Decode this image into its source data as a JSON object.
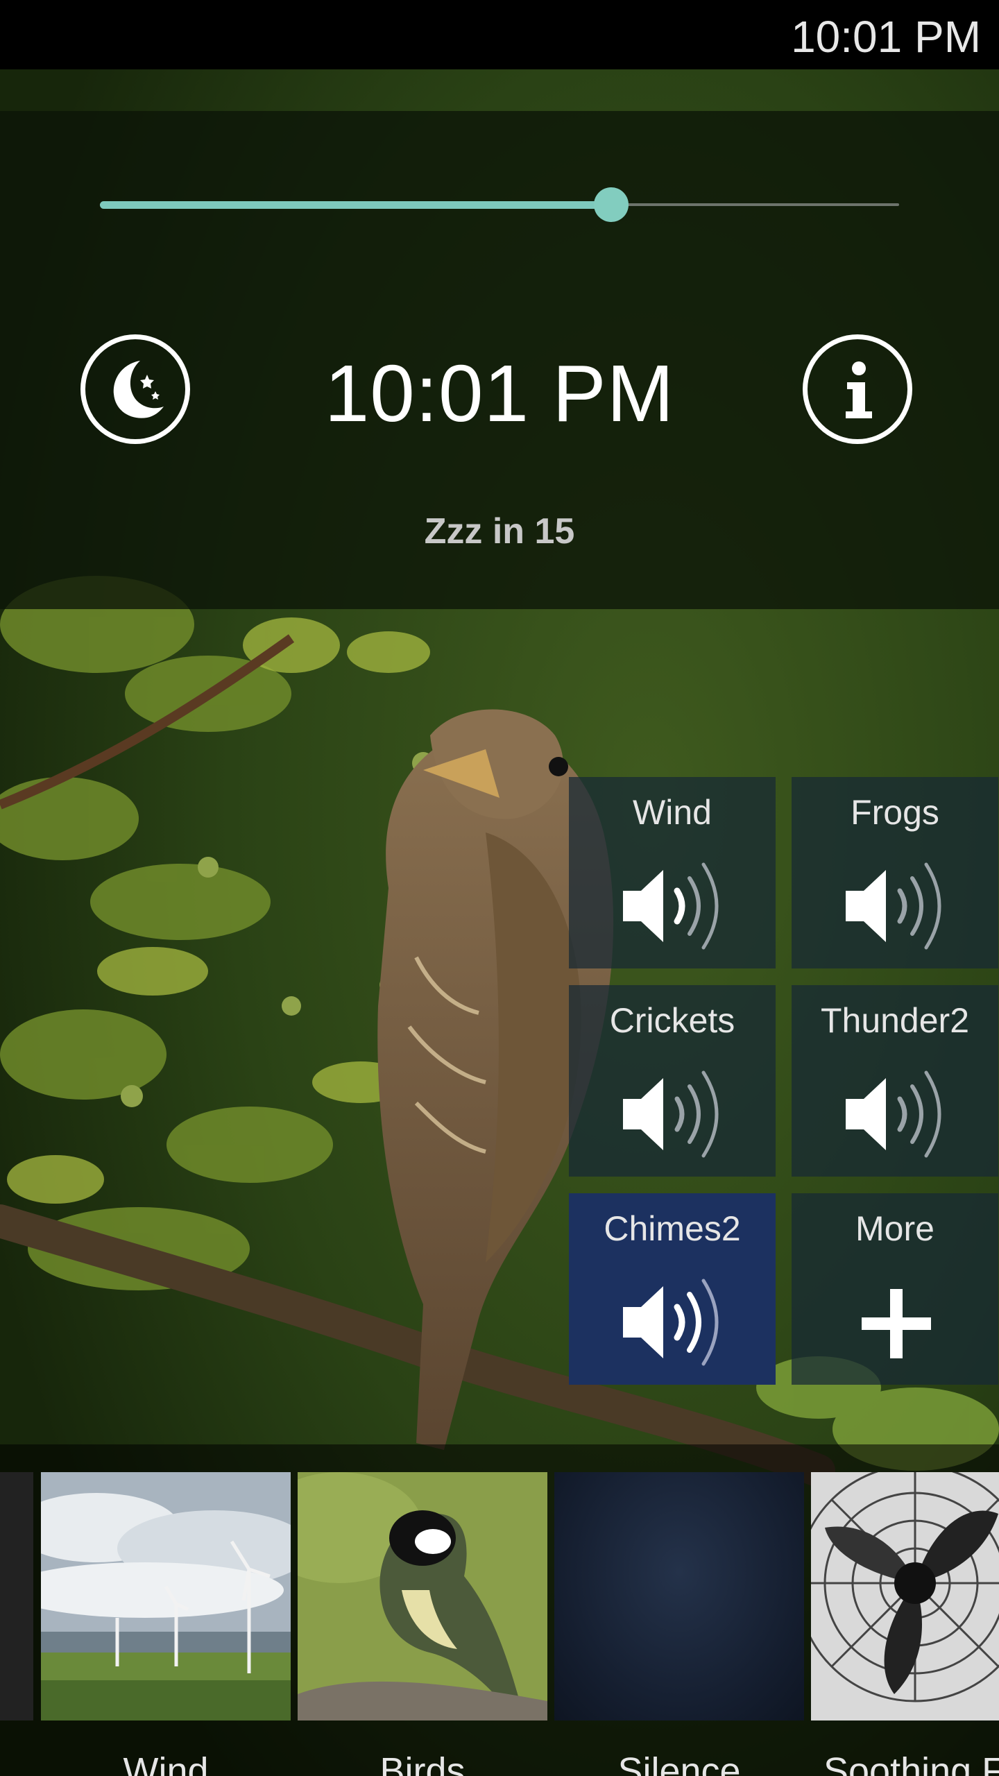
{
  "status_bar": {
    "time": "10:01 PM"
  },
  "sleep_panel": {
    "volume_level": 0.64,
    "clock": "10:01 PM",
    "countdown": "Zzz in 15",
    "moon_icon": "moon-stars-icon",
    "info_icon": "info-icon"
  },
  "sounds": [
    {
      "label": "Wind",
      "icon": "speaker-volume-icon",
      "active": false
    },
    {
      "label": "Frogs",
      "icon": "speaker-volume-icon",
      "active": false
    },
    {
      "label": "Crickets",
      "icon": "speaker-volume-icon",
      "active": false
    },
    {
      "label": "Thunder2",
      "icon": "speaker-volume-icon",
      "active": false
    },
    {
      "label": "Chimes2",
      "icon": "speaker-volume-icon",
      "active": true
    },
    {
      "label": "More",
      "icon": "plus-icon",
      "active": false
    }
  ],
  "scenes": [
    {
      "label": "Wind"
    },
    {
      "label": "Birds"
    },
    {
      "label": "Silence"
    },
    {
      "label": "Soothing F"
    }
  ],
  "colors": {
    "accent": "#7ec9bd",
    "active_tile": "#1c3160",
    "tile": "#16283a"
  }
}
